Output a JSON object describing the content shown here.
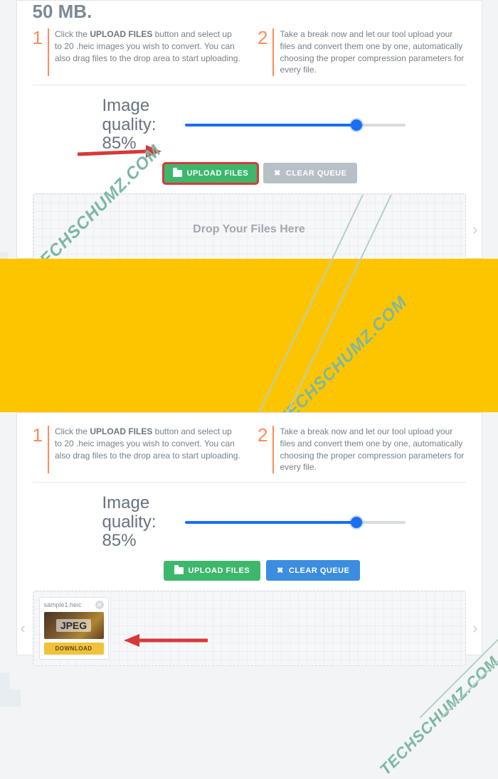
{
  "headline": "50 MB.",
  "steps": [
    {
      "num": "1",
      "prefix": "Click the ",
      "bold": "UPLOAD FILES",
      "rest": " button and select up to 20 .heic images you wish to convert. You can also drag files to the drop area to start uploading."
    },
    {
      "num": "2",
      "text": "Take a break now and let our tool upload your files and convert them one by one, automatically choosing the proper compression parameters for every file."
    }
  ],
  "quality": {
    "label_prefix": "Image quality:",
    "percent": "85%",
    "value": 85
  },
  "buttons": {
    "upload": "UPLOAD FILES",
    "clear": "CLEAR QUEUE"
  },
  "drop_placeholder": "Drop Your Files Here",
  "file": {
    "name": "sample1.heic",
    "badge": "JPEG",
    "download": "DOWNLOAD"
  },
  "watermark": "TECHSCHUMZ.COM",
  "colors": {
    "accent_blue": "#1a6ef0",
    "accent_orange": "#ff8b5a",
    "upload": "#3db76b",
    "clear": "#b7bfc7",
    "yellow": "#fdc500",
    "highlight": "#d63a38"
  }
}
